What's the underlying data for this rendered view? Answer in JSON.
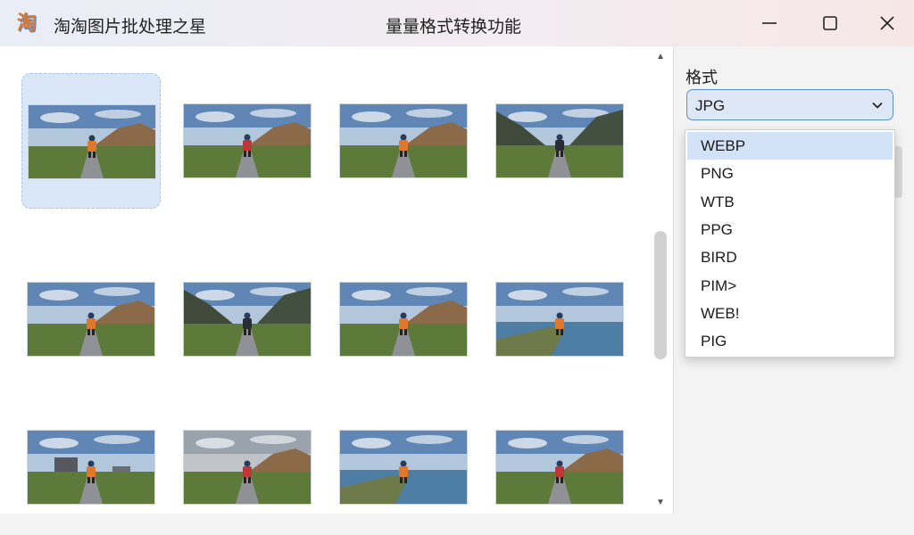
{
  "titlebar": {
    "app_icon_char": "淘",
    "app_name": "淘淘图片批处理之星",
    "window_title": "量量格式转换功能",
    "controls": [
      "minimize-icon",
      "maximize-icon",
      "close-icon"
    ]
  },
  "images": {
    "selected_index": 0,
    "items": [
      {
        "scene": "hills-road",
        "figure_color": "#e0782c"
      },
      {
        "scene": "hills-road",
        "figure_color": "#c03535"
      },
      {
        "scene": "hills-road",
        "figure_color": "#e0782c"
      },
      {
        "scene": "valley-mountains",
        "figure_color": "#2b2b36"
      },
      {
        "scene": "hills-road",
        "figure_color": "#e0782c"
      },
      {
        "scene": "valley-mountains",
        "figure_color": "#2b2b36"
      },
      {
        "scene": "hills-road",
        "figure_color": "#e0782c"
      },
      {
        "scene": "lake",
        "figure_color": "#e0782c"
      },
      {
        "scene": "building-road",
        "figure_color": "#e0782c"
      },
      {
        "scene": "cloudy-road",
        "figure_color": "#c03535"
      },
      {
        "scene": "lake",
        "figure_color": "#e0782c"
      },
      {
        "scene": "hills-road",
        "figure_color": "#c03535"
      }
    ]
  },
  "side": {
    "format_label": "格式",
    "selected_format": "JPG"
  },
  "dropdown": {
    "highlighted_index": 0,
    "options": [
      "WEBP",
      "PNG",
      "WTB",
      "PPG",
      "BIRD",
      "PIM>",
      "WEB!",
      "PIG"
    ]
  },
  "colors": {
    "accent": "#5b8fd0",
    "selection": "#d9e7f8",
    "highlight": "#d3e3f7"
  }
}
